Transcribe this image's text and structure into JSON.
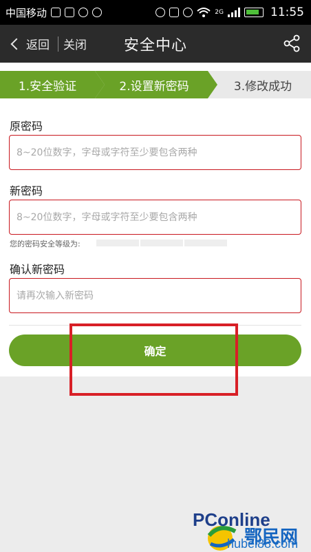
{
  "status_bar": {
    "carrier": "中国移动",
    "network": "2G",
    "time": "11:55"
  },
  "title_bar": {
    "back_label": "返回",
    "close_label": "关闭",
    "title": "安全中心"
  },
  "steps": [
    {
      "label": "1.安全验证",
      "state": "done"
    },
    {
      "label": "2.设置新密码",
      "state": "active"
    },
    {
      "label": "3.修改成功",
      "state": "pending"
    }
  ],
  "form": {
    "old_password": {
      "label": "原密码",
      "placeholder": "8~20位数字，字母或字符至少要包含两种",
      "value": ""
    },
    "new_password": {
      "label": "新密码",
      "placeholder": "8~20位数字，字母或字符至少要包含两种",
      "value": ""
    },
    "strength_label": "您的密码安全等级为:",
    "confirm_password": {
      "label": "确认新密码",
      "placeholder": "请再次输入新密码",
      "value": ""
    },
    "submit_label": "确定"
  },
  "watermark": {
    "brand": "PConline",
    "site": "鄂民网",
    "url": "hubei88.com"
  },
  "colors": {
    "accent_green": "#6aa227",
    "error_red": "#c8161d",
    "annotation_red": "#d81f26",
    "titlebar": "#2b2b2b"
  }
}
